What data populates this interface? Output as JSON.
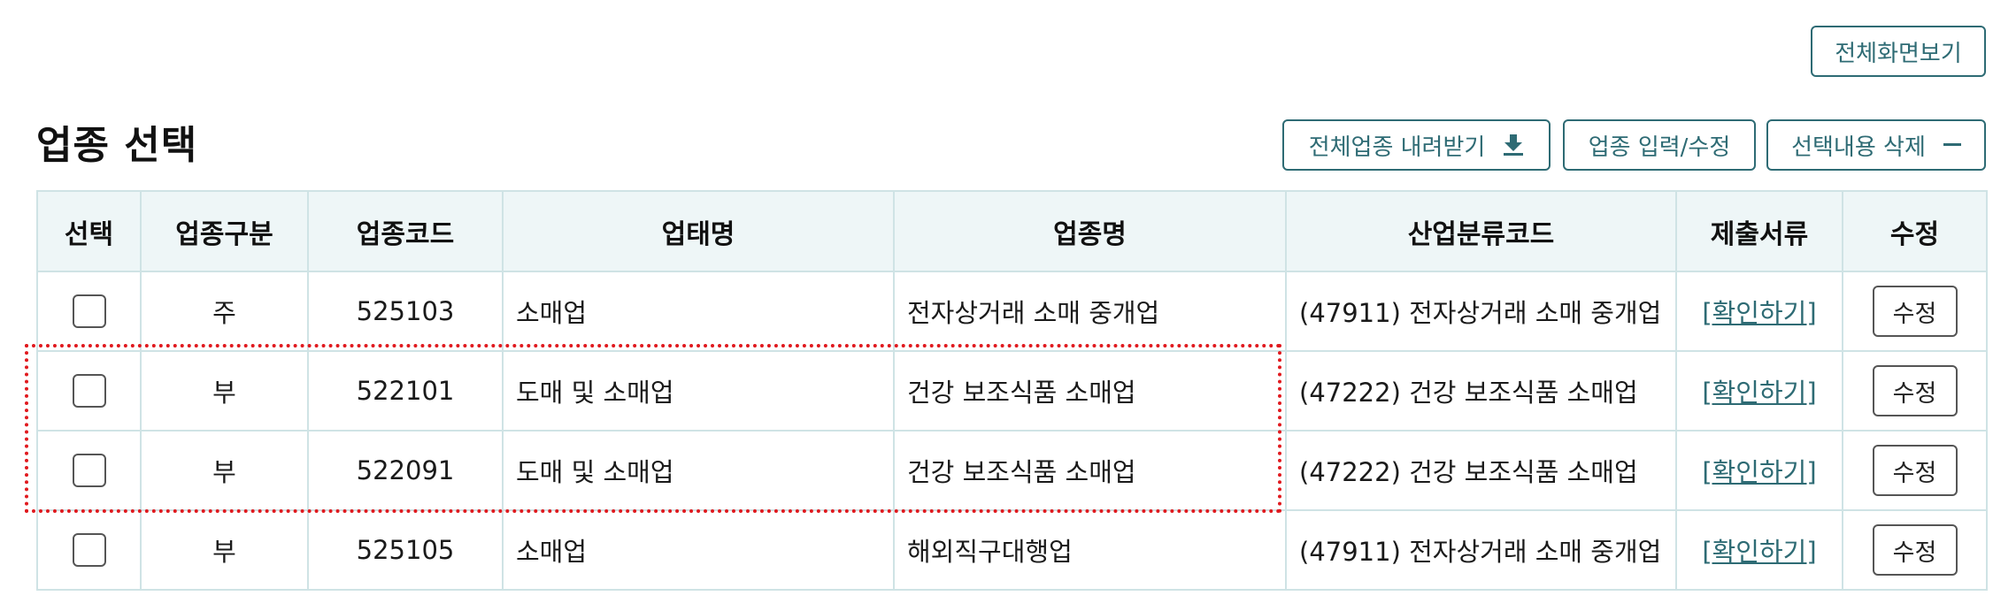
{
  "toolbar": {
    "fullscreen_label": "전체화면보기",
    "download_label": "전체업종 내려받기",
    "edit_label": "업종 입력/수정",
    "delete_label": "선택내용 삭제"
  },
  "section": {
    "title": "업종 선택"
  },
  "table": {
    "headers": {
      "select": "선택",
      "type": "업종구분",
      "code": "업종코드",
      "business": "업태명",
      "industry": "업종명",
      "classification": "산업분류코드",
      "docs": "제출서류",
      "edit": "수정"
    },
    "rows": [
      {
        "type": "주",
        "code": "525103",
        "business": "소매업",
        "industry": "전자상거래 소매 중개업",
        "classification": "(47911) 전자상거래 소매 중개업",
        "docs": "[확인하기]",
        "edit": "수정"
      },
      {
        "type": "부",
        "code": "522101",
        "business": "도매 및 소매업",
        "industry": "건강 보조식품 소매업",
        "classification": "(47222) 건강 보조식품 소매업",
        "docs": "[확인하기]",
        "edit": "수정"
      },
      {
        "type": "부",
        "code": "522091",
        "business": "도매 및 소매업",
        "industry": "건강 보조식품 소매업",
        "classification": "(47222) 건강 보조식품 소매업",
        "docs": "[확인하기]",
        "edit": "수정"
      },
      {
        "type": "부",
        "code": "525105",
        "business": "소매업",
        "industry": "해외직구대행업",
        "classification": "(47911) 전자상거래 소매 중개업",
        "docs": "[확인하기]",
        "edit": "수정"
      }
    ]
  },
  "colors": {
    "accent": "#2e6b74",
    "header_bg": "#eef6f7",
    "border": "#cfe3e5",
    "highlight": "#e0191e"
  }
}
